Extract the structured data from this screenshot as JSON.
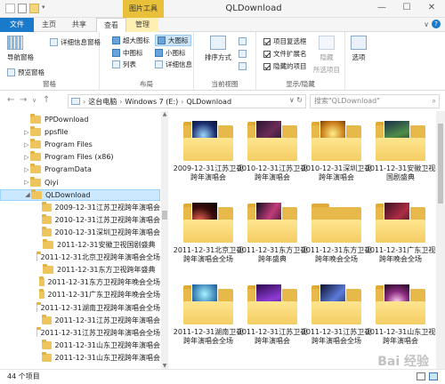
{
  "window": {
    "title": "QLDownload",
    "picture_tools": "图片工具",
    "min": "—",
    "max": "☐",
    "close": "✕"
  },
  "tabs": {
    "file": "文件",
    "home": "主页",
    "share": "共享",
    "view": "查看",
    "manage": "管理"
  },
  "ribbon": {
    "panes": {
      "label": "窗格",
      "nav_pane": "导航窗格",
      "preview_pane": "预览窗格",
      "details_pane": "详细信息窗格"
    },
    "layout": {
      "label": "布局",
      "extra_large": "超大图标",
      "large": "大图标",
      "medium": "中图标",
      "small": "小图标",
      "list": "列表",
      "details": "详细信息"
    },
    "current_view": {
      "label": "当前视图",
      "sort_by": "排序方式"
    },
    "show_hide": {
      "label": "显示/隐藏",
      "item_checkboxes": "项目复选框",
      "file_extensions": "文件扩展名",
      "hidden_items": "隐藏的项目",
      "hide_selected_1": "隐藏",
      "hide_selected_2": "所选项目"
    },
    "options": "选项"
  },
  "addressbar": {
    "path": [
      "这台电脑",
      "Windows 7 (E:)",
      "QLDownload"
    ],
    "search_placeholder": "搜索\"QLDownload\""
  },
  "tree": {
    "items": [
      {
        "label": "PPDownload",
        "expand": ""
      },
      {
        "label": "ppsfile",
        "expand": "▷"
      },
      {
        "label": "Program Files",
        "expand": "▷"
      },
      {
        "label": "Program Files (x86)",
        "expand": "▷"
      },
      {
        "label": "ProgramData",
        "expand": "▷"
      },
      {
        "label": "Qiyi",
        "expand": "▷"
      },
      {
        "label": "QLDownload",
        "expand": "◢"
      },
      {
        "label": "2009-12-31江苏卫视跨年演唱会",
        "expand": ""
      },
      {
        "label": "2010-12-31江苏卫视跨年演唱会",
        "expand": ""
      },
      {
        "label": "2010-12-31深圳卫视跨年演唱会",
        "expand": ""
      },
      {
        "label": "2011-12-31安徽卫视国剧盛典",
        "expand": ""
      },
      {
        "label": "2011-12-31北京卫视跨年演唱会全场",
        "expand": ""
      },
      {
        "label": "2011-12-31东方卫视跨年盛典",
        "expand": ""
      },
      {
        "label": "2011-12-31东方卫视跨年晚会全场",
        "expand": ""
      },
      {
        "label": "2011-12-31广东卫视跨年晚会全场",
        "expand": ""
      },
      {
        "label": "2011-12-31湖南卫视跨年演唱会全场",
        "expand": ""
      },
      {
        "label": "2011-12-31江苏卫视跨年演唱会",
        "expand": ""
      },
      {
        "label": "2011-12-31江苏卫视跨年演唱会全场",
        "expand": ""
      },
      {
        "label": "2011-12-31山东卫视跨年演唱会",
        "expand": ""
      },
      {
        "label": "2011-12-31山东卫视跨年演唱会",
        "expand": ""
      }
    ]
  },
  "content": {
    "folders": [
      {
        "label": "2009-12-31江苏卫视跨年演唱会",
        "img": "img-1"
      },
      {
        "label": "2010-12-31江苏卫视跨年演唱会",
        "img": "img-2"
      },
      {
        "label": "2010-12-31深圳卫视跨年演唱会",
        "img": "img-3"
      },
      {
        "label": "2011-12-31安徽卫视国剧盛典",
        "img": "img-4"
      },
      {
        "label": "2011-12-31北京卫视跨年演唱会全场",
        "img": "img-5"
      },
      {
        "label": "2011-12-31东方卫视跨年盛典",
        "img": "img-6"
      },
      {
        "label": "2011-12-31东方卫视跨年晚会全场",
        "img": ""
      },
      {
        "label": "2011-12-31广东卫视跨年晚会全场",
        "img": "img-7"
      },
      {
        "label": "2011-12-31湖南卫视跨年演唱会全场",
        "img": "img-8"
      },
      {
        "label": "2011-12-31江苏卫视跨年演唱会",
        "img": "img-9"
      },
      {
        "label": "2011-12-31江苏卫视跨年演唱会全场",
        "img": "img-10"
      },
      {
        "label": "2011-12-31山东卫视跨年演唱会",
        "img": "img-11"
      }
    ]
  },
  "status": {
    "count": "44 个项目"
  },
  "watermark": "Bai 经验"
}
